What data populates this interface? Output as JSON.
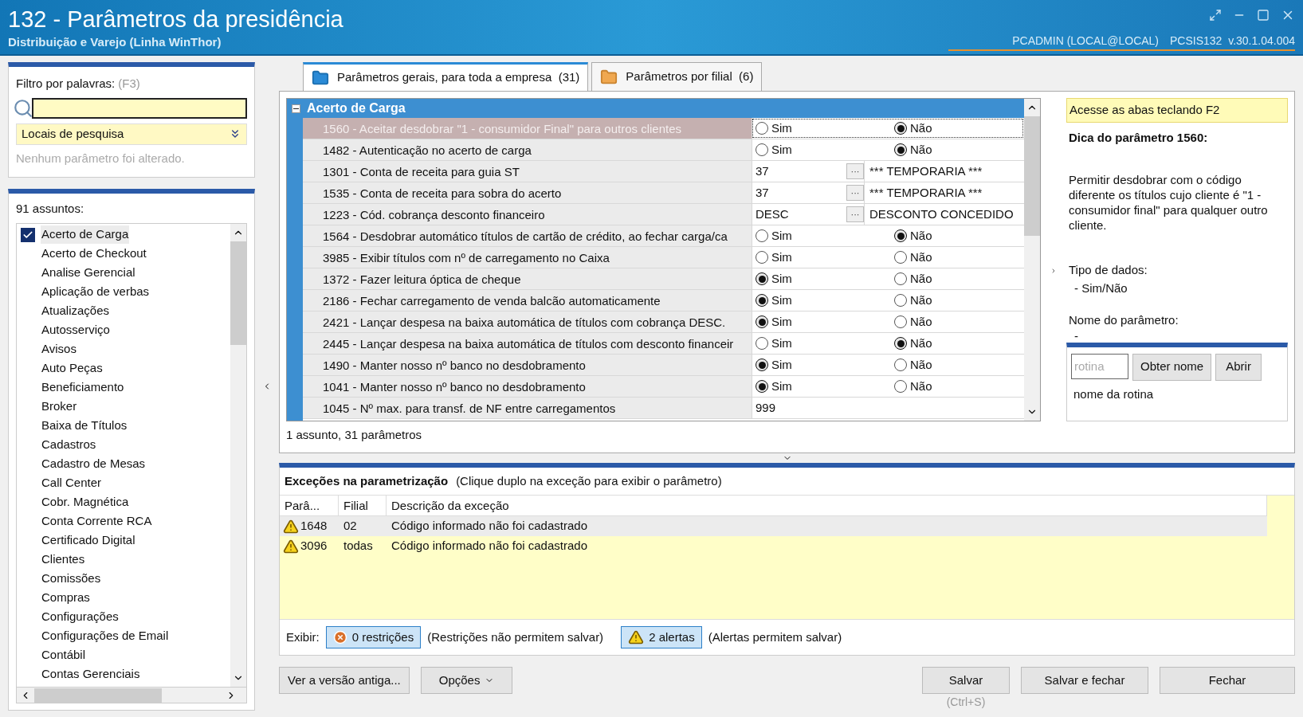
{
  "window": {
    "title": "132 - Parâmetros da presidência",
    "subtitle": "Distribuição e Varejo (Linha WinThor)",
    "user": "PCADMIN (LOCAL@LOCAL)",
    "version": "PCSIS132  v.30.1.04.004"
  },
  "filter": {
    "label": "Filtro por palavras:",
    "shortcut": "(F3)",
    "search_places": "Locais de pesquisa",
    "status": "Nenhum parâmetro foi alterado."
  },
  "subjects": {
    "count": "91 assuntos:",
    "items": [
      {
        "label": "Acerto de Carga",
        "checked": true
      },
      {
        "label": "Acerto de Checkout",
        "checked": false
      },
      {
        "label": "Analise Gerencial",
        "checked": false
      },
      {
        "label": "Aplicação de verbas",
        "checked": false
      },
      {
        "label": "Atualizações",
        "checked": false
      },
      {
        "label": "Autosserviço",
        "checked": false
      },
      {
        "label": "Avisos",
        "checked": false
      },
      {
        "label": "Auto Peças",
        "checked": false
      },
      {
        "label": "Beneficiamento",
        "checked": false
      },
      {
        "label": "Broker",
        "checked": false
      },
      {
        "label": "Baixa de Títulos",
        "checked": false
      },
      {
        "label": "Cadastros",
        "checked": false
      },
      {
        "label": "Cadastro de Mesas",
        "checked": false
      },
      {
        "label": "Call Center",
        "checked": false
      },
      {
        "label": "Cobr. Magnética",
        "checked": false
      },
      {
        "label": "Conta Corrente RCA",
        "checked": false
      },
      {
        "label": "Certificado Digital",
        "checked": false
      },
      {
        "label": "Clientes",
        "checked": false
      },
      {
        "label": "Comissões",
        "checked": false
      },
      {
        "label": "Compras",
        "checked": false
      },
      {
        "label": "Configurações",
        "checked": false
      },
      {
        "label": "Configurações de Email",
        "checked": false
      },
      {
        "label": "Contábil",
        "checked": false
      },
      {
        "label": "Contas Gerenciais",
        "checked": false
      }
    ]
  },
  "tabs": [
    {
      "label": "Parâmetros gerais, para toda a empresa  (31)",
      "selected": true
    },
    {
      "label": "Parâmetros por filial  (6)",
      "selected": false
    }
  ],
  "grid": {
    "group": "Acerto de Carga",
    "rows": [
      {
        "label": "1560 - Aceitar desdobrar \"1 - consumidor Final\" para outros clientes",
        "kind": "radio",
        "selected": true,
        "options": [
          {
            "label": "Sim",
            "selected": false
          },
          {
            "label": "Não",
            "selected": true
          }
        ]
      },
      {
        "label": "1482 - Autenticação no acerto de carga",
        "kind": "radio",
        "selected": false,
        "options": [
          {
            "label": "Sim",
            "selected": false
          },
          {
            "label": "Não",
            "selected": true
          }
        ]
      },
      {
        "label": "1301 - Conta de receita para guia ST",
        "kind": "lookup",
        "selected": false,
        "value": "37",
        "description": "*** TEMPORARIA ***",
        "button": "···"
      },
      {
        "label": "1535 - Conta de receita para sobra do acerto",
        "kind": "lookup",
        "selected": false,
        "value": "37",
        "description": "*** TEMPORARIA ***",
        "button": "···"
      },
      {
        "label": "1223 - Cód. cobrança desconto financeiro",
        "kind": "lookup",
        "selected": false,
        "value": "DESC",
        "description": "DESCONTO CONCEDIDO",
        "button": "···"
      },
      {
        "label": "1564 - Desdobrar automático títulos de cartão de crédito, ao fechar carga/ca",
        "kind": "radio",
        "selected": false,
        "options": [
          {
            "label": "Sim",
            "selected": false
          },
          {
            "label": "Não",
            "selected": true
          }
        ]
      },
      {
        "label": "3985 - Exibir títulos com nº de carregamento no Caixa",
        "kind": "radio",
        "selected": false,
        "options": [
          {
            "label": "Sim",
            "selected": false
          },
          {
            "label": "Não",
            "selected": false
          }
        ]
      },
      {
        "label": "1372 - Fazer leitura óptica de cheque",
        "kind": "radio",
        "selected": false,
        "options": [
          {
            "label": "Sim",
            "selected": true
          },
          {
            "label": "Não",
            "selected": false
          }
        ]
      },
      {
        "label": "2186 - Fechar carregamento de venda balcão automaticamente",
        "kind": "radio",
        "selected": false,
        "options": [
          {
            "label": "Sim",
            "selected": true
          },
          {
            "label": "Não",
            "selected": false
          }
        ]
      },
      {
        "label": "2421 - Lançar despesa na baixa automática de títulos com cobrança DESC.",
        "kind": "radio",
        "selected": false,
        "options": [
          {
            "label": "Sim",
            "selected": true
          },
          {
            "label": "Não",
            "selected": false
          }
        ]
      },
      {
        "label": "2445 - Lançar despesa na baixa automática de títulos com desconto financeir",
        "kind": "radio",
        "selected": false,
        "options": [
          {
            "label": "Sim",
            "selected": false
          },
          {
            "label": "Não",
            "selected": true
          }
        ]
      },
      {
        "label": "1490 - Manter nosso nº banco no desdobramento",
        "kind": "radio",
        "selected": false,
        "options": [
          {
            "label": "Sim",
            "selected": true
          },
          {
            "label": "Não",
            "selected": false
          }
        ]
      },
      {
        "label": "1041 - Manter nosso nº banco no desdobramento",
        "kind": "radio",
        "selected": false,
        "options": [
          {
            "label": "Sim",
            "selected": true
          },
          {
            "label": "Não",
            "selected": false
          }
        ]
      },
      {
        "label": "1045 - Nº max. para transf. de NF entre carregamentos",
        "kind": "text",
        "selected": false,
        "value": "999"
      }
    ],
    "summary": "1 assunto, 31 parâmetros"
  },
  "help": {
    "hint": "Acesse as abas teclando F2",
    "title": "Dica do parâmetro 1560:",
    "text": "Permitir desdobrar com o código diferente os títulos cujo cliente é \"1 - consumidor final\" para qualquer outro cliente.",
    "type_label": "Tipo de dados:",
    "type_value": "- Sim/Não",
    "name_label": "Nome do parâmetro:",
    "name_value": "-",
    "routine_placeholder": "rotina",
    "get_name": "Obter nome",
    "open": "Abrir",
    "routine_name": "nome da rotina"
  },
  "exceptions": {
    "title": "Exceções na parametrização",
    "hint": "(Clique duplo na exceção para exibir o parâmetro)",
    "columns": [
      "Parâ...",
      "Filial",
      "Descrição da exceção"
    ],
    "rows": [
      {
        "param": "1648",
        "branch": "02",
        "description": "Código informado não foi cadastrado",
        "selected": true
      },
      {
        "param": "3096",
        "branch": "todas",
        "description": "Código informado não foi cadastrado",
        "selected": false
      }
    ],
    "show_label": "Exibir:",
    "restrictions": {
      "label": "0 restrições",
      "pressed": true
    },
    "restrictions_note": "(Restrições não permitem salvar)",
    "alerts": {
      "label": "2 alertas",
      "pressed": true
    },
    "alerts_note": "(Alertas permitem salvar)"
  },
  "buttons": {
    "old_version": "Ver a versão antiga...",
    "options": "Opções",
    "save": "Salvar",
    "save_shortcut": "(Ctrl+S)",
    "save_close": "Salvar e fechar",
    "close": "Fechar"
  }
}
